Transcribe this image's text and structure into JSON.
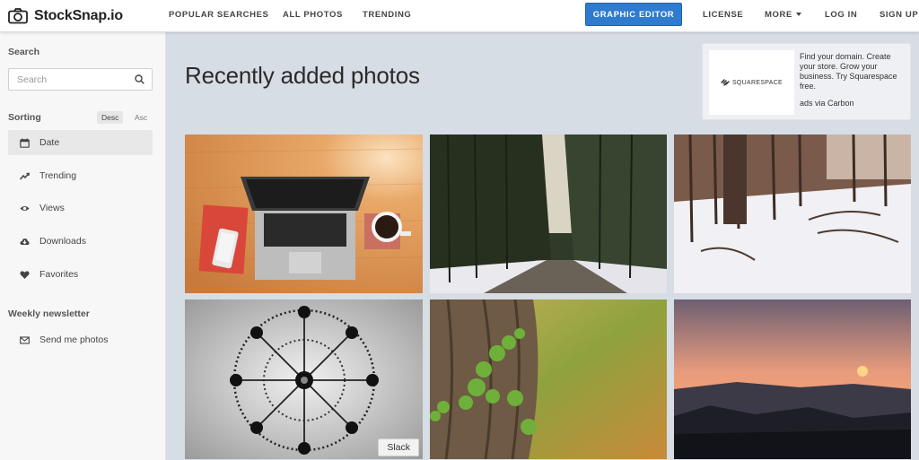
{
  "header": {
    "brand": "StockSnap.io",
    "nav": {
      "popular": "POPULAR SEARCHES",
      "all_photos": "ALL PHOTOS",
      "trending": "TRENDING",
      "graphic_editor": "GRAPHIC EDITOR",
      "license": "LICENSE",
      "more": "MORE",
      "login": "LOG IN",
      "signup": "SIGN UP"
    }
  },
  "sidebar": {
    "search_heading": "Search",
    "search_placeholder": "Search",
    "sorting_heading": "Sorting",
    "sort_desc": "Desc",
    "sort_asc": "Asc",
    "items": [
      {
        "label": "Date",
        "icon": "calendar-icon"
      },
      {
        "label": "Trending",
        "icon": "trending-icon"
      },
      {
        "label": "Views",
        "icon": "eye-icon"
      },
      {
        "label": "Downloads",
        "icon": "cloud-download-icon"
      },
      {
        "label": "Favorites",
        "icon": "heart-icon"
      }
    ],
    "newsletter_heading": "Weekly newsletter",
    "newsletter_item": {
      "label": "Send me photos",
      "icon": "envelope-icon"
    }
  },
  "main": {
    "title": "Recently added photos",
    "ad": {
      "logo_text": "SQUARESPACE",
      "text": "Find your domain. Create your store. Grow your business. Try Squarespace free.",
      "via": "ads via Carbon"
    },
    "photos": [
      {
        "subject": "laptop-on-desk"
      },
      {
        "subject": "snowy-forest-road"
      },
      {
        "subject": "snowy-woods"
      },
      {
        "subject": "chandelier",
        "tag": "Slack"
      },
      {
        "subject": "ivy-on-tree-bark"
      },
      {
        "subject": "sunset-over-hills"
      }
    ]
  },
  "colors": {
    "accent": "#2e7bcf",
    "main_bg": "#d7dde5",
    "sidebar_bg": "#f7f7f7"
  }
}
